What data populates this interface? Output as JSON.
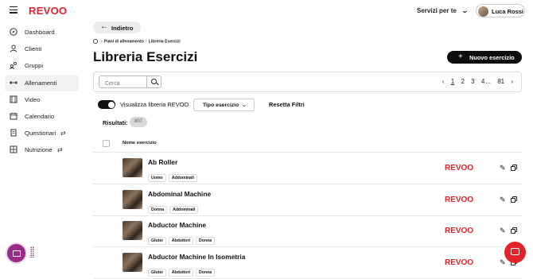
{
  "brand": {
    "logo": "REVOO",
    "color": "#e2232b"
  },
  "header": {
    "services_label": "Servizi per te",
    "user_name": "Luca Rossi"
  },
  "sidebar": {
    "items": [
      {
        "label": "Dashboard",
        "icon": "compass-icon",
        "active": false
      },
      {
        "label": "Clienti",
        "icon": "user-icon",
        "active": false
      },
      {
        "label": "Gruppi",
        "icon": "group-icon",
        "active": false
      },
      {
        "label": "Allenamenti",
        "icon": "dumbbell-icon",
        "active": true
      },
      {
        "label": "Video",
        "icon": "film-icon",
        "active": false
      },
      {
        "label": "Calendario",
        "icon": "calendar-icon",
        "active": false
      },
      {
        "label": "Questionari",
        "icon": "document-icon",
        "active": false,
        "extra_icon": "switch-icon"
      },
      {
        "label": "Nutrizione",
        "icon": "grid-icon",
        "active": false,
        "extra_icon": "switch-icon"
      }
    ]
  },
  "back_label": "Indietro",
  "breadcrumb": {
    "items": [
      "Piani di allenamento",
      "Libreria Esercizi"
    ]
  },
  "page_title": "Libreria Esercizi",
  "new_button_label": "Nuovo esercizio",
  "search": {
    "placeholder": "Cerca",
    "value": ""
  },
  "pagination": {
    "pages": [
      "1",
      "2",
      "3",
      "4"
    ],
    "ellipsis": "...",
    "last": "81",
    "current": "1"
  },
  "filters": {
    "toggle_label": "Visualizza libreria REVOO",
    "toggle_on": true,
    "type_select_label": "Tipo esercizio",
    "reset_label": "Resetta Filtri"
  },
  "results": {
    "label": "Risultati:",
    "count": "807"
  },
  "table": {
    "column_header": "Nome esercizio",
    "rows": [
      {
        "name": "Ab Roller",
        "tags": [
          "Uomo",
          "Addominali"
        ],
        "source": "REVOO"
      },
      {
        "name": "Abdominal Machine",
        "tags": [
          "Donna",
          "Addominali"
        ],
        "source": "REVOO"
      },
      {
        "name": "Abductor Machine",
        "tags": [
          "Glutei",
          "Abduttori",
          "Donna"
        ],
        "source": "REVOO"
      },
      {
        "name": "Abductor Machine In Isometria",
        "tags": [
          "Glutei",
          "Abduttori",
          "Donna"
        ],
        "source": "REVOO"
      }
    ]
  }
}
